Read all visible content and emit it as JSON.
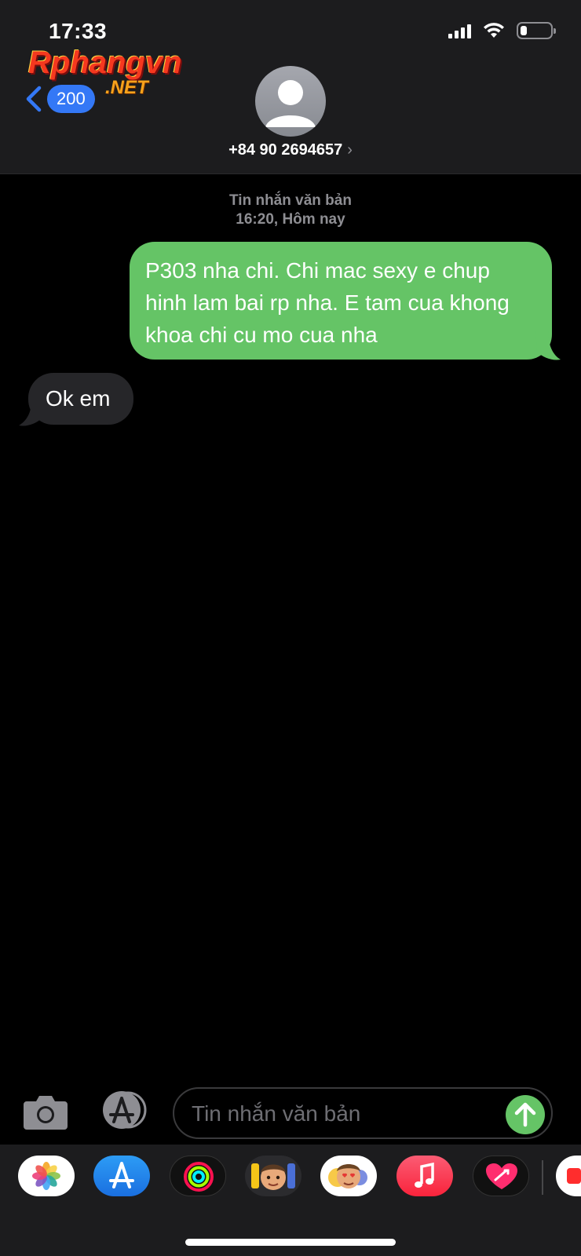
{
  "status_bar": {
    "time": "17:33"
  },
  "watermark": {
    "main": "Rphangvn",
    "suffix": ".NET"
  },
  "header": {
    "back_badge": "200",
    "contact": "+84 90 2694657"
  },
  "thread": {
    "meta_type": "Tin nhắn văn bản",
    "meta_time": "16:20, Hôm nay",
    "messages": [
      {
        "direction": "outgoing",
        "text": "P303 nha chi. Chi mac sexy e chup hinh lam bai rp nha. E tam cua khong khoa chi cu mo cua nha"
      },
      {
        "direction": "incoming",
        "text": "Ok em"
      }
    ]
  },
  "composer": {
    "placeholder": "Tin nhắn văn bản"
  },
  "app_drawer": {
    "apps": [
      "photos-app",
      "app-store",
      "activity",
      "memoji-stickers",
      "animoji",
      "music",
      "digital-touch",
      "partial-app"
    ]
  },
  "colors": {
    "outgoing_bubble": "#65c466",
    "incoming_bubble": "#262629",
    "accent": "#3478f6"
  }
}
